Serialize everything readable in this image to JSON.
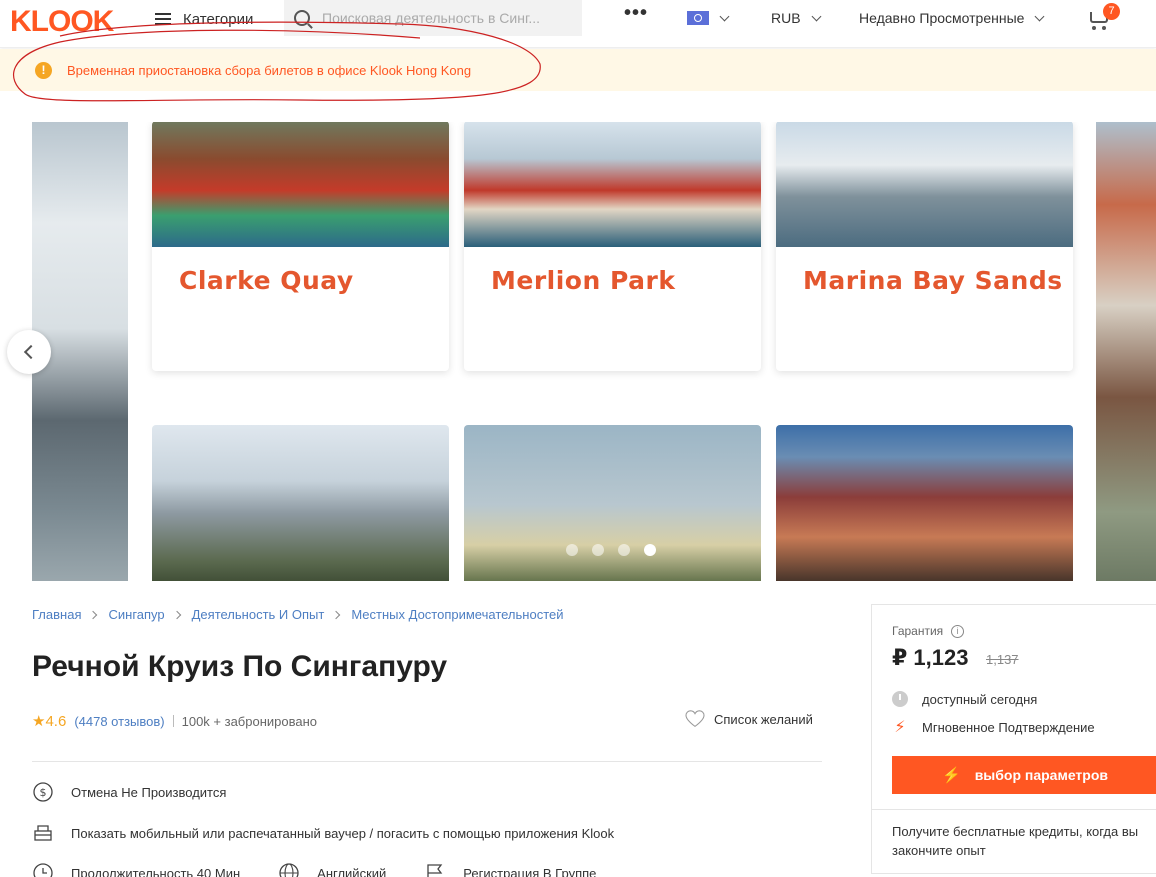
{
  "header": {
    "logo": "KLOOK",
    "categories_label": "Категории",
    "search_placeholder": "Поисковая деятельность в Синг...",
    "more_label": "•••",
    "currency": "RUB",
    "recently_viewed": "Недавно Просмотренные",
    "cart_count": "7"
  },
  "notice": {
    "icon": "!",
    "text": "Временная приостановка сбора билетов в офисе Klook Hong Kong"
  },
  "banner": {
    "cards": [
      {
        "title": "Clarke Quay"
      },
      {
        "title": "Merlion Park"
      },
      {
        "title": "Marina Bay Sands"
      }
    ],
    "slides_count": 4,
    "active_slide": 4
  },
  "breadcrumb": [
    "Главная",
    "Сингапур",
    "Деятельность И Опыт",
    "Местных Достопримечательностей"
  ],
  "product": {
    "title": "Речной Круиз По Сингапуру",
    "star": "★",
    "rating": "4.6",
    "reviews": "(4478 отзывов)",
    "booked": "100k + забронировано",
    "wishlist": "Список желаний"
  },
  "features": {
    "cancellation": "Отмена Не Производится",
    "voucher": "Показать мобильный или распечатанный ваучер / погасить с помощью приложения Klook",
    "duration": "Продолжительность 40 Мин",
    "language": "Английский",
    "registration": "Регистрация В Группе"
  },
  "booking": {
    "guarantee": "Гарантия",
    "price": "₽ 1,123",
    "old_price": "1,137",
    "available": "доступный сегодня",
    "instant_confirm": "Мгновенное Подтверждение",
    "select_button": "выбор параметров",
    "credits_text": "Получите бесплатные кредиты, когда вы закончите опыт"
  },
  "colors": {
    "brand": "#ff5722",
    "link": "#4d7ec2",
    "star": "#f5a623",
    "notice_bg": "#fff8e6"
  }
}
